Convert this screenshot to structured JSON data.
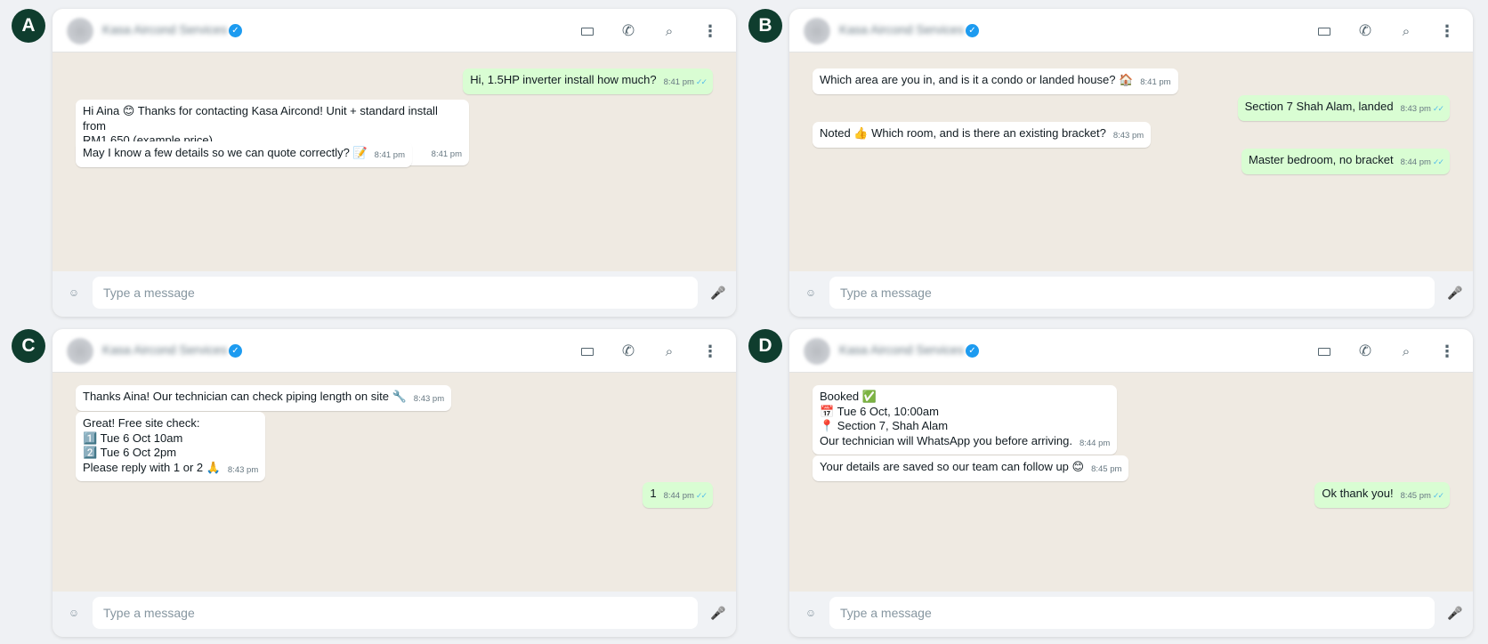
{
  "contact": {
    "name": "Kasa Aircond Services",
    "verified": "✓"
  },
  "composer": {
    "placeholder": "Type a message"
  },
  "icons": {
    "video": "video-camera-icon",
    "call": "phone-call-icon",
    "search": "search-icon",
    "menu": "more-vertical-icon",
    "emoji": "emoji-icon",
    "mic": "microphone-icon"
  },
  "colors": {
    "badge": "#0f3d2e",
    "chat_background": "#efeae2",
    "incoming_bubble": "#ffffff",
    "outgoing_bubble": "#d9fdd3",
    "read_ticks": "#53bdeb",
    "verified": "#1d9bf0"
  },
  "panels": [
    {
      "label": "A",
      "messages": [
        {
          "dir": "out",
          "text": "Hi, 1.5HP inverter install how much?",
          "time": "8:41 pm",
          "ticks": "✓✓"
        },
        {
          "dir": "in",
          "text": "Hi Aina 😊 Thanks for contacting Kasa Aircond! Unit + standard install from\nRM1,650 (example price).",
          "time": "8:41 pm"
        },
        {
          "dir": "in",
          "text": "May I know a few details so we can quote correctly? 📝",
          "time": "8:41 pm"
        }
      ]
    },
    {
      "label": "B",
      "messages": [
        {
          "dir": "in",
          "text": "Which area are you in, and is it a condo or landed house? 🏠",
          "time": "8:41 pm"
        },
        {
          "dir": "out",
          "text": "Section 7 Shah Alam, landed",
          "time": "8:43 pm",
          "ticks": "✓✓"
        },
        {
          "dir": "in",
          "text": "Noted 👍 Which room, and is there an existing bracket?",
          "time": "8:43 pm"
        },
        {
          "dir": "out",
          "text": "Master bedroom, no bracket",
          "time": "8:44 pm",
          "ticks": "✓✓"
        }
      ]
    },
    {
      "label": "C",
      "messages": [
        {
          "dir": "in",
          "text": "Thanks Aina! Our technician can check piping length on site 🔧",
          "time": "8:43 pm"
        },
        {
          "dir": "in",
          "text": "Great! Free site check:\n1️⃣ Tue 6 Oct 10am\n2️⃣ Tue 6 Oct 2pm\nPlease reply with 1 or 2 🙏",
          "time": "8:43 pm"
        },
        {
          "dir": "out",
          "text": "1",
          "time": "8:44 pm",
          "ticks": "✓✓"
        }
      ]
    },
    {
      "label": "D",
      "messages": [
        {
          "dir": "in",
          "text": "Booked ✅\n📅 Tue 6 Oct, 10:00am\n📍 Section 7, Shah Alam\nOur technician will WhatsApp you before arriving.",
          "time": "8:44 pm"
        },
        {
          "dir": "in",
          "text": "Your details are saved so our team can follow up 😊",
          "time": "8:45 pm"
        },
        {
          "dir": "out",
          "text": "Ok thank you!",
          "time": "8:45 pm",
          "ticks": "✓✓"
        }
      ]
    }
  ]
}
